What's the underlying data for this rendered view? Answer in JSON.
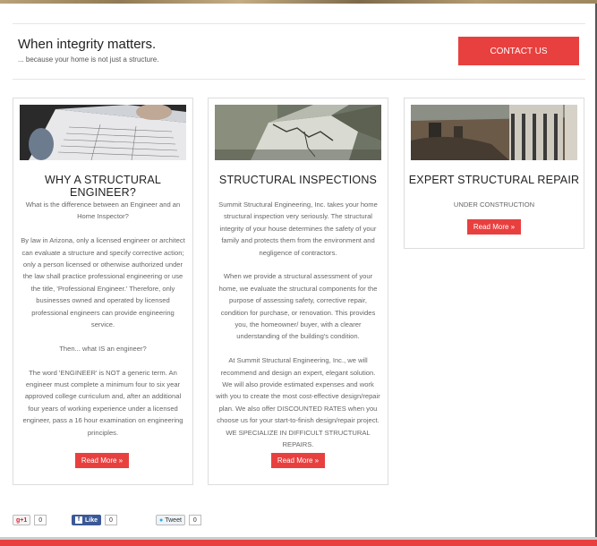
{
  "header": {
    "title": "When integrity matters.",
    "subtitle": "... because your home is not just a structure.",
    "contact_label": "CONTACT US"
  },
  "cards": [
    {
      "title": "WHY A STRUCTURAL ENGINEER?",
      "paragraphs": [
        "What is the difference between an Engineer and an Home Inspector?",
        "By law in Arizona, only a licensed engineer or architect can evaluate a structure and specify corrective action; only a person licensed or otherwise authorized under the law shall practice professional engineering or use the title, 'Professional Engineer.' Therefore, only businesses owned and operated by licensed professional engineers can provide engineering service.",
        "Then... what IS an engineer?",
        "The word 'ENGINEER' is NOT a generic term. An engineer must complete a minimum four to six year approved college curriculum and, after an additional four years of working experience under a licensed engineer, pass a 16 hour examination on engineering principles."
      ],
      "read_more": "Read More »"
    },
    {
      "title": "STRUCTURAL INSPECTIONS",
      "paragraphs": [
        "Summit Structural Engineering, Inc. takes your home structural inspection very seriously. The structural integrity of your house determines the safety of your family and protects them from the environment and negligence of contractors.",
        "When we provide a structural assessment of your home, we evaluate the structural components for the purpose of assessing safety, corrective repair, condition for purchase, or renovation. This provides you, the homeowner/ buyer, with a clearer understanding of the building's condition.",
        "At Summit Structural Engineering, Inc., we will recommend and design an expert, elegant solution. We will also provide estimated expenses and work with you to create the most cost-effective design/repair plan. We also offer DISCOUNTED RATES when you choose us for your start-to-finish design/repair project. WE SPECIALIZE IN DIFFICULT STRUCTURAL REPAIRS."
      ],
      "read_more": "Read More »"
    },
    {
      "title": "EXPERT STRUCTURAL REPAIR",
      "paragraphs": [
        "UNDER CONSTRUCTION"
      ],
      "read_more": "Read More »"
    }
  ],
  "social": {
    "gplus_label": "g+1",
    "gplus_count": "0",
    "fb_label": "Like",
    "fb_count": "0",
    "tweet_label": "Tweet",
    "tweet_count": "0"
  }
}
